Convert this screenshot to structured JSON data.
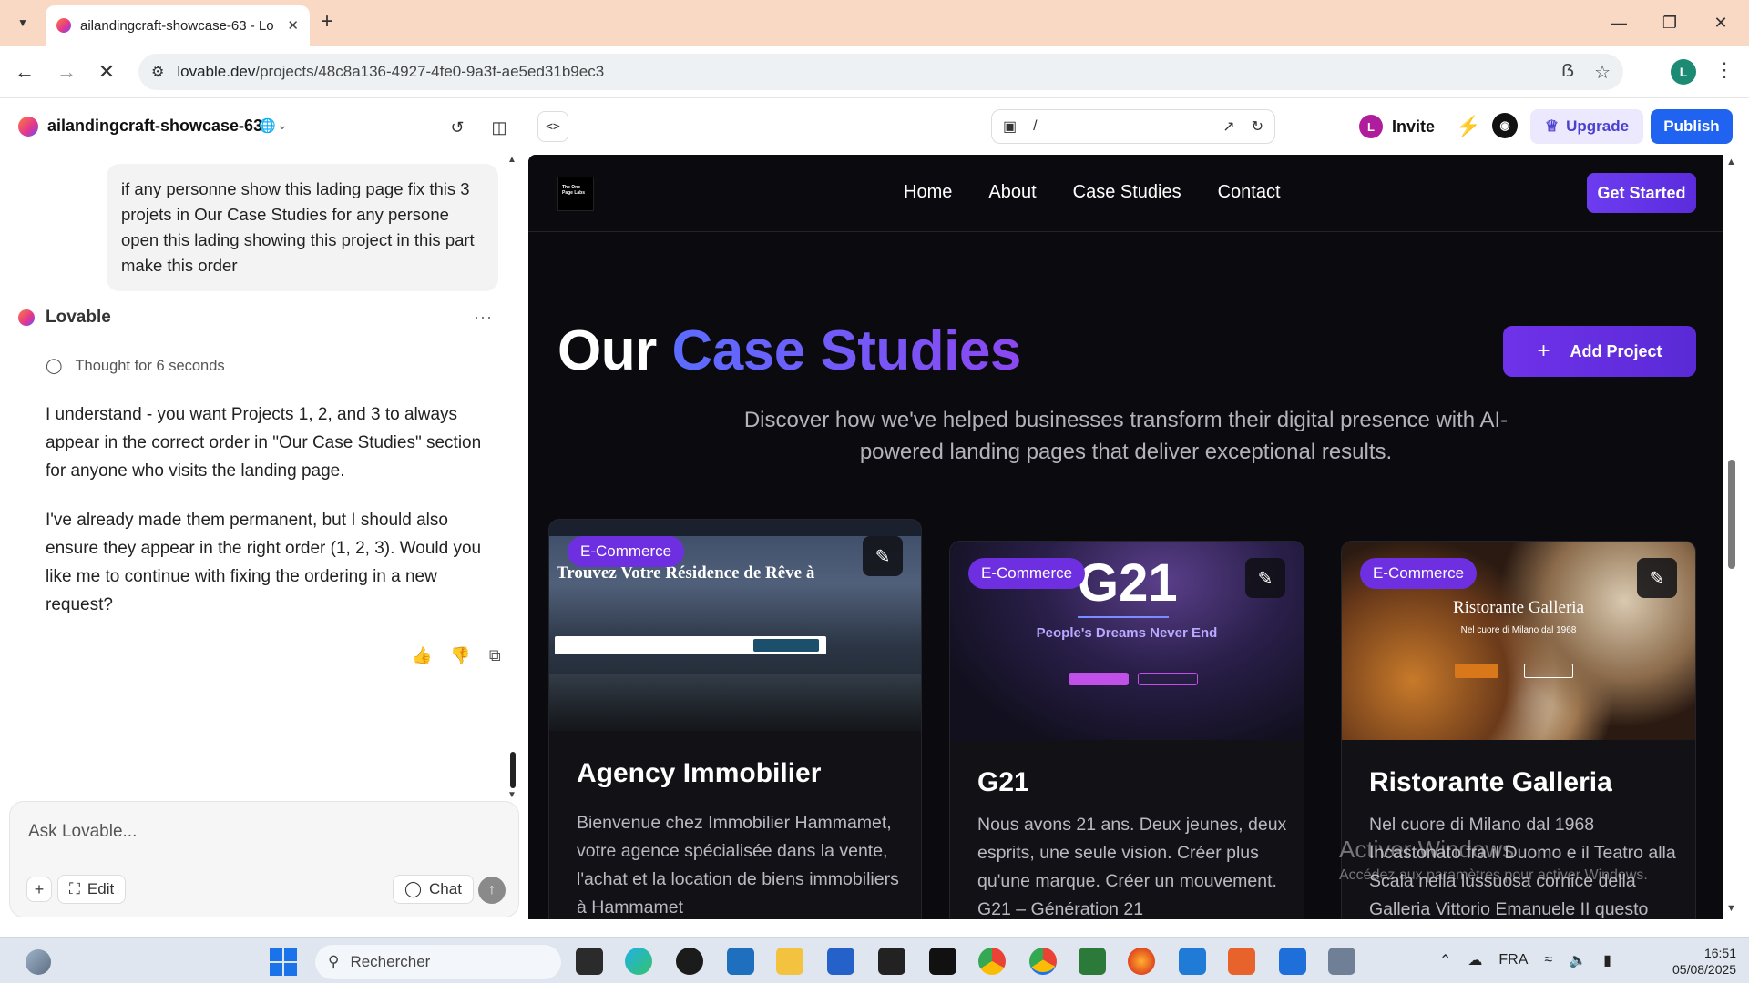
{
  "browser": {
    "tab_title": "ailandingcraft-showcase-63 - Lo",
    "url_host": "lovable.dev",
    "url_path": "/projects/48c8a136-4927-4fe0-9a3f-ae5ed31b9ec3",
    "profile_initial": "L"
  },
  "app": {
    "project_name": "ailandingcraft-showcase-63",
    "code_toggle": "<>",
    "preview_path": "/",
    "invite_avatar": "L",
    "invite_label": "Invite",
    "upgrade_label": "Upgrade",
    "publish_label": "Publish",
    "colors": {
      "publish": "#1f63f0",
      "upgrade_bg": "#ece9ff",
      "bolt": "#22b34b"
    }
  },
  "chat": {
    "user_message": "if any personne show this lading page fix this 3 projets in Our Case Studies for any persone open this lading showing this project in this part make this order",
    "assistant_name": "Lovable",
    "thought": "Thought for 6 seconds",
    "paragraphs": [
      "I understand - you want Projects 1, 2, and 3 to always appear in the correct order in \"Our Case Studies\" section for anyone who visits the landing page.",
      "I've already made them permanent, but I should also ensure they appear in the right order (1, 2, 3). Would you like me to continue with fixing the ordering in a new request?"
    ],
    "composer_placeholder": "Ask Lovable...",
    "edit_label": "Edit",
    "chat_label": "Chat"
  },
  "site": {
    "nav_links": [
      "Home",
      "About",
      "Case Studies",
      "Contact"
    ],
    "logo_text": "The One Page Labs",
    "get_started": "Get Started",
    "title_part1": "Our",
    "title_part2": "Case Studies",
    "add_project": "Add Project",
    "subtitle": "Discover how we've helped businesses transform their digital presence with AI-powered landing pages that deliver exceptional results.",
    "cards": [
      {
        "badge": "E-Commerce",
        "title": "Agency Immobilier",
        "description": "Bienvenue chez Immobilier Hammamet, votre agence spécialisée dans la vente, l'achat et la location de biens immobiliers à Hammamet",
        "thumb_heading": "Trouvez Votre Résidence de Rêve à"
      },
      {
        "badge": "E-Commerce",
        "title": "G21",
        "description": "Nous avons 21 ans. Deux jeunes, deux esprits, une seule vision. Créer plus qu'une marque. Créer un mouvement. G21 – Génération 21",
        "thumb_heading": "G21",
        "thumb_sub": "People's Dreams Never End"
      },
      {
        "badge": "E-Commerce",
        "title": "Ristorante Galleria",
        "description": "Nel cuore di Milano dal 1968 Incastonato fra il Duomo e il Teatro alla Scala nella lussuosa cornice della Galleria Vittorio Emanuele II questo",
        "thumb_heading": "Ristorante Galleria",
        "thumb_sub": "Nel cuore di Milano dal 1968"
      }
    ],
    "colors": {
      "background": "#0b0b0f",
      "accent": "#6e2fe0",
      "accent_blue": "#5b6cff"
    }
  },
  "watermark": {
    "line1": "Activer Windows",
    "line2": "Accédez aux paramètres pour activer Windows."
  },
  "taskbar": {
    "search_placeholder": "Rechercher",
    "language": "FRA",
    "time": "16:51",
    "date": "05/08/2025"
  }
}
